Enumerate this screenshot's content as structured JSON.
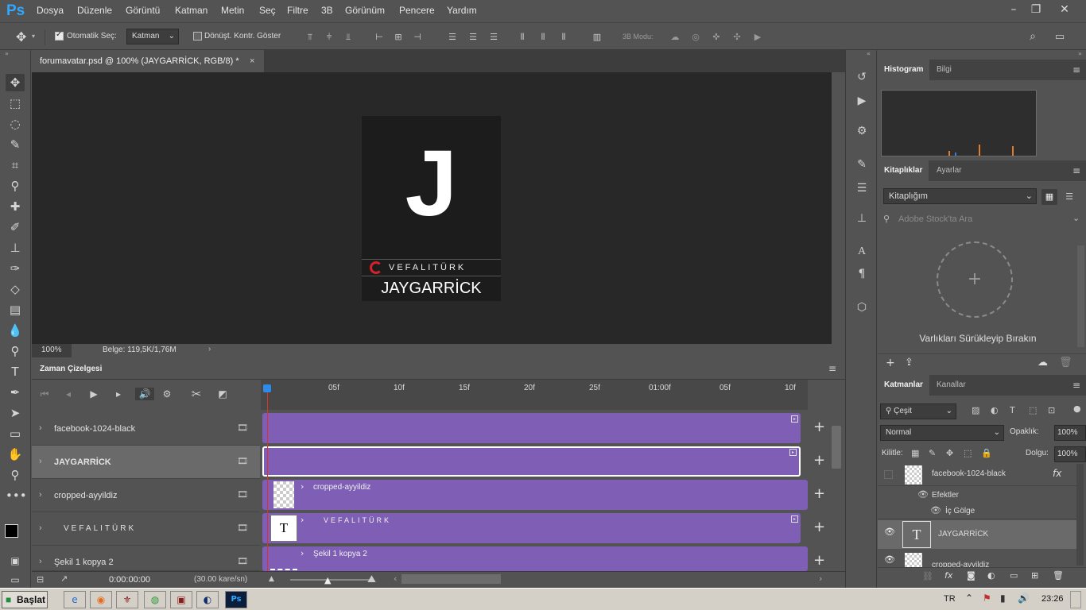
{
  "app": {
    "logo": "Ps"
  },
  "menu": [
    "Dosya",
    "Düzenle",
    "Görüntü",
    "Katman",
    "Metin",
    "Seç",
    "Filtre",
    "3B",
    "Görünüm",
    "Pencere",
    "Yardım"
  ],
  "window_controls": {
    "minimize": "–",
    "restore": "❐",
    "close": "✕"
  },
  "options": {
    "auto_select_label": "Otomatik Seç:",
    "auto_select_checked": true,
    "layer_mode": "Katman",
    "transform_label": "Dönüşt. Kontr. Göster",
    "mode3d_label": "3B Modu:"
  },
  "document": {
    "tab_title": "forumavatar.psd @ 100% (JAYGARRİCK, RGB/8) *",
    "close_glyph": "×",
    "big_letter": "J",
    "brand": "VEFALITÜRK",
    "name": "JAYGARRİCK"
  },
  "status": {
    "zoom": "100%",
    "doc_info": "Belge: 119,5K/1,76M"
  },
  "timeline": {
    "title": "Zaman Çizelgesi",
    "ticks": [
      "05f",
      "10f",
      "15f",
      "20f",
      "25f",
      "01:00f",
      "05f",
      "10f"
    ],
    "timecode": "0:00:00:00",
    "fps": "(30.00 kare/sn)",
    "layers": [
      {
        "name": "facebook-1024-black",
        "clip": ""
      },
      {
        "name": "JAYGARRİCK",
        "clip": ""
      },
      {
        "name": "cropped-ayyildiz",
        "clip": "cropped-ayyildiz"
      },
      {
        "name": "VEFALITÜRK",
        "clip": "VEFALITÜRK"
      },
      {
        "name": "Şekil 1 kopya 2",
        "clip": "Şekil 1 kopya 2"
      }
    ]
  },
  "panels": {
    "histogram": {
      "tab1": "Histogram",
      "tab2": "Bilgi"
    },
    "libraries": {
      "tab1": "Kitaplıklar",
      "tab2": "Ayarlar",
      "library_select": "Kitaplığım",
      "search_placeholder": "Adobe Stock'ta Ara",
      "drop_hint": "Varlıkları Sürükleyip Bırakın"
    },
    "layers": {
      "tab1": "Katmanlar",
      "tab2": "Kanallar",
      "filter": "Çeşit",
      "blend": "Normal",
      "opacity_label": "Opaklık:",
      "opacity": "100%",
      "lock_label": "Kilitle:",
      "fill_label": "Dolgu:",
      "fill": "100%",
      "items": [
        {
          "name": "facebook-1024-black",
          "fx": "fx"
        },
        {
          "name": "Efektler"
        },
        {
          "name": "İç Gölge"
        },
        {
          "name": "JAYGARRİCK"
        },
        {
          "name": "cropped-ayyildiz"
        }
      ]
    }
  },
  "taskbar": {
    "start": "Başlat",
    "lang": "TR",
    "clock": "23:26"
  },
  "colors": {
    "accent": "#31a8ff",
    "clip": "#7e5fb5",
    "playhead": "#e0302c"
  }
}
